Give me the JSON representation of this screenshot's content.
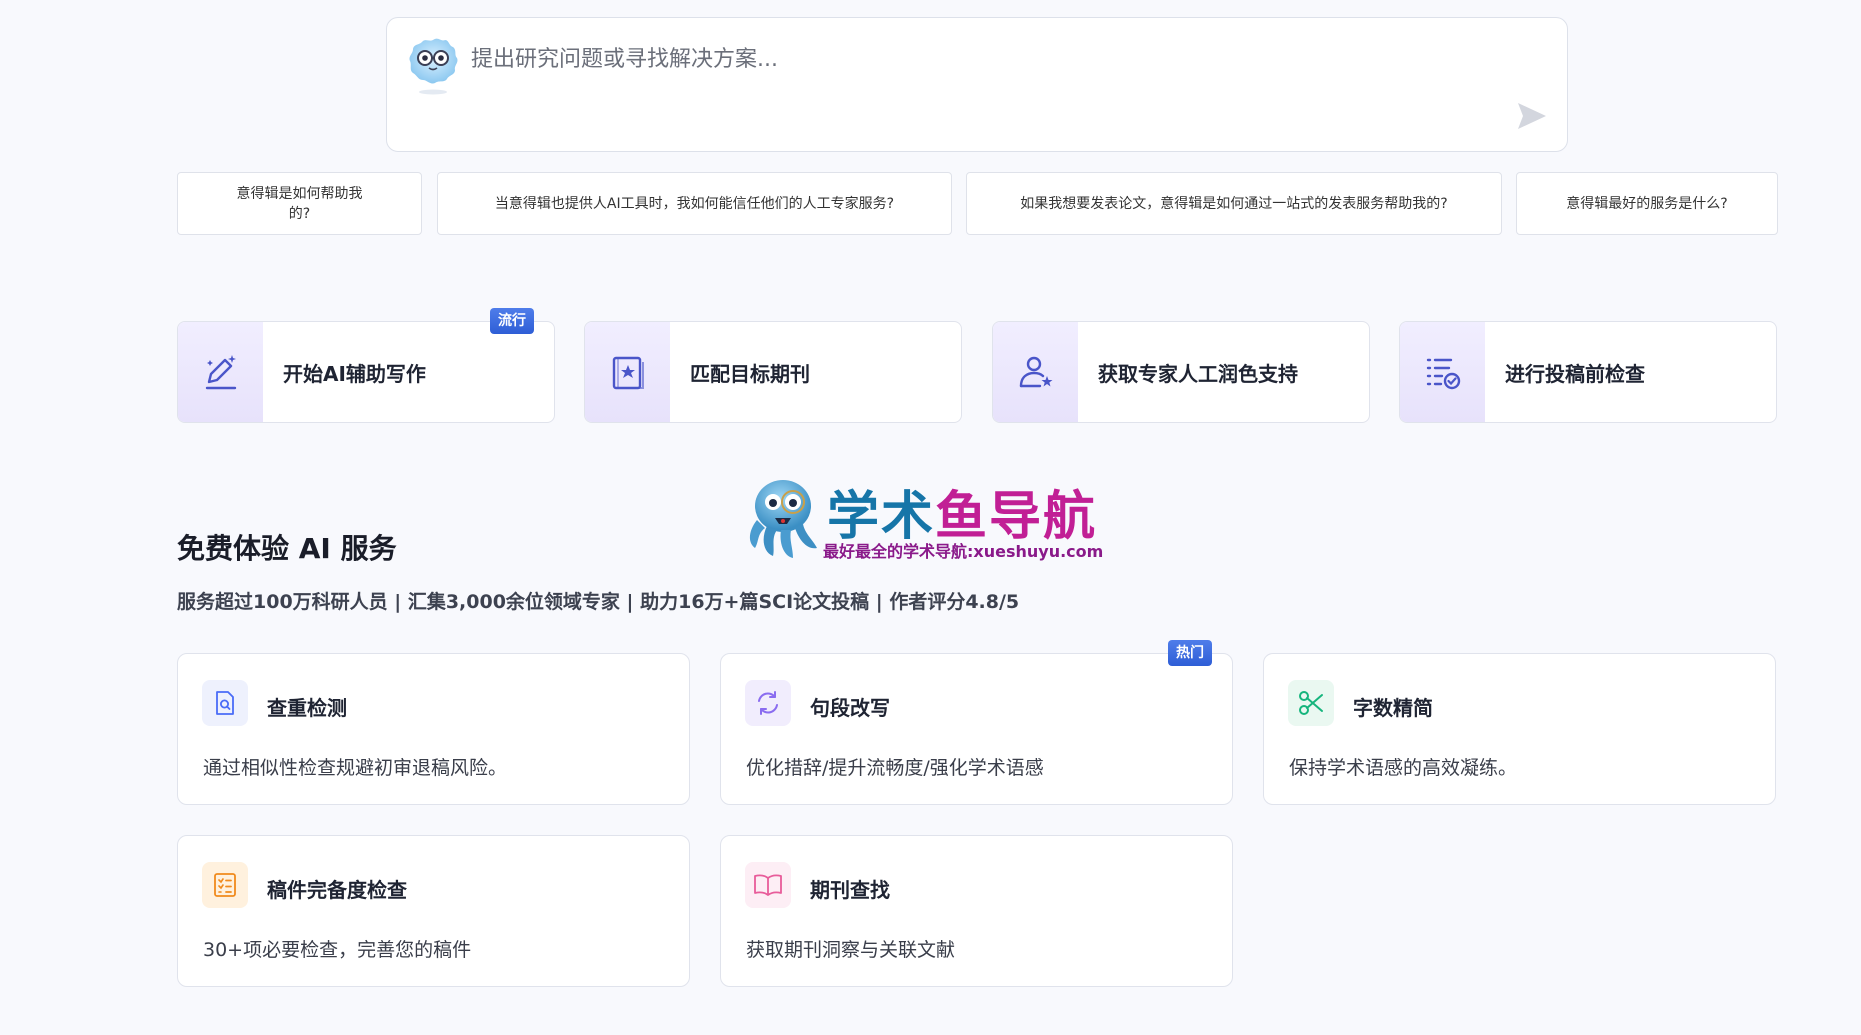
{
  "search": {
    "placeholder": "提出研究问题或寻找解决方案..."
  },
  "suggestions": [
    {
      "label": "意得辑是如何帮助我的?"
    },
    {
      "label": "当意得辑也提供人AI工具时，我如何能信任他们的人工专家服务?"
    },
    {
      "label": "如果我想要发表论文，意得辑是如何通过一站式的发表服务帮助我的?"
    },
    {
      "label": "意得辑最好的服务是什么?"
    }
  ],
  "actions": [
    {
      "label": "开始AI辅助写作",
      "icon": "pen-sparkle-icon",
      "badge": "流行"
    },
    {
      "label": "匹配目标期刊",
      "icon": "journal-star-icon"
    },
    {
      "label": "获取专家人工润色支持",
      "icon": "expert-person-icon"
    },
    {
      "label": "进行投稿前检查",
      "icon": "checklist-icon"
    }
  ],
  "watermark": {
    "title_a": "学术",
    "title_b": "鱼导航",
    "subtitle": "最好最全的学术导航:xueshuyu.com"
  },
  "section": {
    "title": "免费体验 AI 服务",
    "subtitle": "服务超过100万科研人员 | 汇集3,000余位领域专家 | 助力16万+篇SCI论文投稿 | 作者评分4.8/5"
  },
  "services": [
    {
      "title": "查重检测",
      "desc": "通过相似性检查规避初审退稿风险。",
      "icon": "document-search-icon",
      "color": "#4a6cf7"
    },
    {
      "title": "句段改写",
      "desc": "优化措辞/提升流畅度/强化学术语感",
      "icon": "refresh-icon",
      "color": "#8a6cf0",
      "badge": "热门"
    },
    {
      "title": "字数精简",
      "desc": "保持学术语感的高效凝练。",
      "icon": "scissors-icon",
      "color": "#16b57d"
    },
    {
      "title": "稿件完备度检查",
      "desc": "30+项必要检查，完善您的稿件",
      "icon": "list-check-icon",
      "color": "#f08a1c"
    },
    {
      "title": "期刊查找",
      "desc": "获取期刊洞察与关联文献",
      "icon": "book-open-icon",
      "color": "#e85c9a"
    }
  ]
}
